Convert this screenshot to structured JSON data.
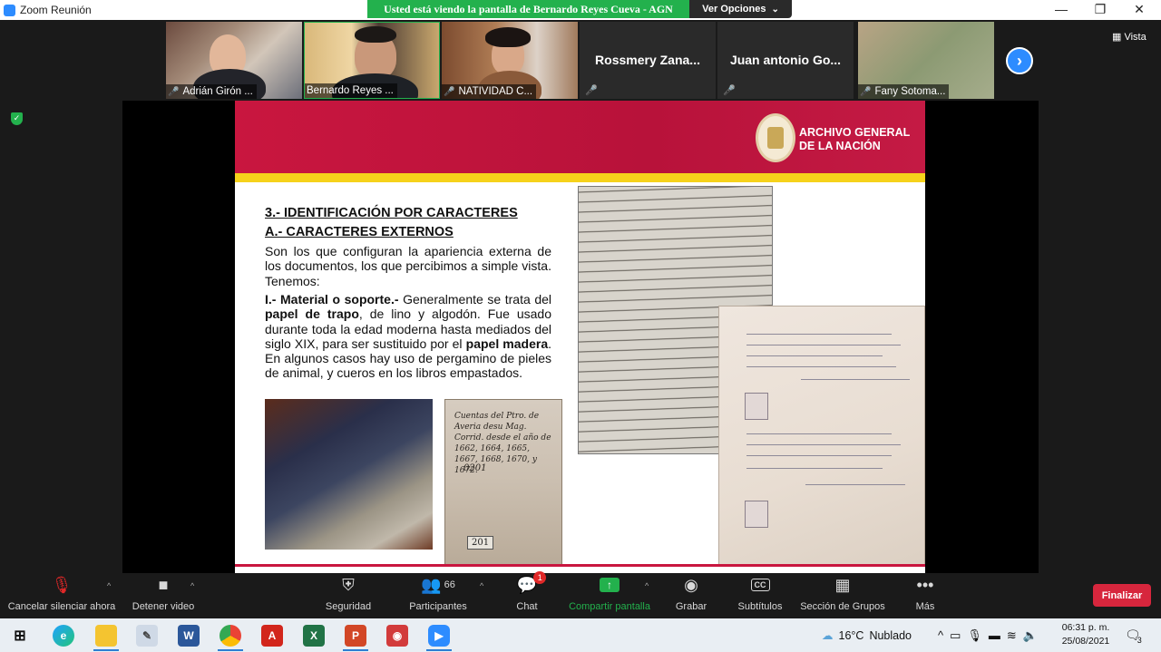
{
  "window": {
    "title": "Zoom Reunión",
    "share_banner": "Usted está viendo la pantalla de Bernardo Reyes Cueva - AGN",
    "view_options": "Ver Opciones",
    "view_options_caret": "⌄",
    "minimize": "—",
    "maximize": "❐",
    "close": "✕",
    "vista": "Vista"
  },
  "participants": [
    {
      "name": "Adrián Girón ...",
      "video": true
    },
    {
      "name": "Bernardo Reyes ...",
      "video": true
    },
    {
      "name": "NATIVIDAD C...",
      "video": true
    },
    {
      "name": "Rossmery Zana...",
      "video": false
    },
    {
      "name": "Juan antonio Go...",
      "video": false
    },
    {
      "name": "Fany Sotoma...",
      "video": true
    }
  ],
  "next_page_icon": "chevron-right-icon",
  "slide": {
    "logo_line1": "ARCHIVO GENERAL",
    "logo_line2": "DE LA NACIÓN",
    "heading1": "3.- IDENTIFICACIÓN POR CARACTERES",
    "heading2": "A.- CARACTERES EXTERNOS",
    "para1": "Son los que configuran la apariencia externa de los documentos, los que percibimos a simple vista. Tenemos:",
    "para2_a": "I.- Material o soporte.-",
    "para2_b": " Generalmente se trata del ",
    "para2_c": "papel de trapo",
    "para2_d": ", de lino y algodón. Fue usado durante toda la edad moderna hasta mediados del siglo XIX, para ser sustituido por el ",
    "para2_e": "papel madera",
    "para2_f": ". En algunos casos hay uso de pergamino de pieles de animal, y cueros en los libros empastados.",
    "cover_text": "Cuentas del Ptro. de Averia desu Mag. Corrid. desde el año de 1662, 1664, 1665, 1667, 1668, 1670, y 1672.",
    "cover_number": "0201",
    "cover_tag": "201"
  },
  "toolbar": {
    "mute": "Cancelar silenciar ahora",
    "video": "Detener video",
    "security": "Seguridad",
    "participants": "Participantes",
    "participants_count": "66",
    "chat": "Chat",
    "chat_badge": "1",
    "share": "Compartir pantalla",
    "record": "Grabar",
    "subtitles": "Subtítulos",
    "subtitles_icon_text": "CC",
    "groups": "Sección de Grupos",
    "more": "Más",
    "end": "Finalizar"
  },
  "taskbar": {
    "weather_temp": "16°C",
    "weather_desc": "Nublado",
    "time": "06:31 p. m.",
    "date": "25/08/2021",
    "notifications": "3"
  },
  "colors": {
    "share_green": "#23b14d",
    "zoom_blue": "#2d8cff",
    "slide_red": "#c9163f",
    "slide_yellow": "#f6d21b",
    "end_red": "#d7263d"
  }
}
